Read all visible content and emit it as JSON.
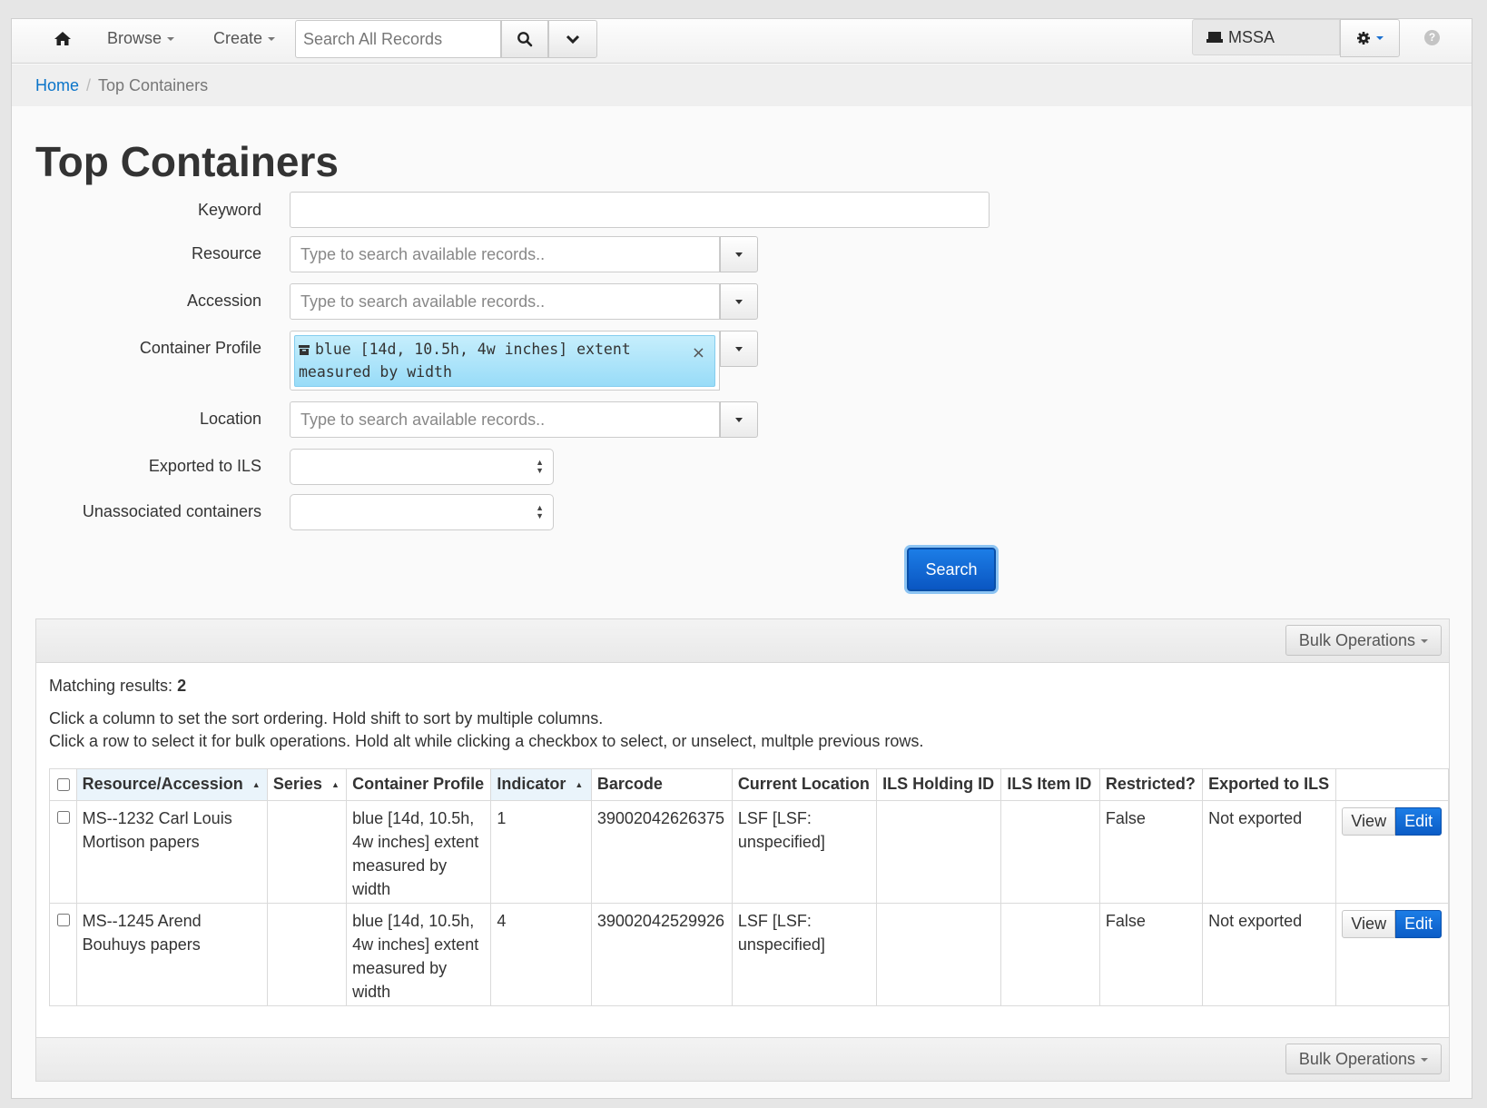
{
  "navbar": {
    "browse_label": "Browse",
    "create_label": "Create",
    "search_placeholder": "Search All Records",
    "repository_label": "MSSA",
    "help_label": "?"
  },
  "breadcrumb": {
    "home": "Home",
    "current": "Top Containers"
  },
  "page_title": "Top Containers",
  "form": {
    "keyword_label": "Keyword",
    "keyword_value": "",
    "resource_label": "Resource",
    "accession_label": "Accession",
    "container_profile_label": "Container Profile",
    "container_profile_token": "blue [14d, 10.5h, 4w inches] extent measured by width",
    "token_close": "×",
    "location_label": "Location",
    "exported_label": "Exported to ILS",
    "unassociated_label": "Unassociated containers",
    "typeahead_placeholder": "Type to search available records..",
    "search_button": "Search"
  },
  "results": {
    "bulk_operations_label": "Bulk Operations",
    "matching_label": "Matching results:",
    "matching_count": "2",
    "help_line_1": "Click a column to set the sort ordering. Hold shift to sort by multiple columns.",
    "help_line_2": "Click a row to select it for bulk operations. Hold alt while clicking a checkbox to select, or unselect, multple previous rows.",
    "columns": {
      "resource": "Resource/Accession",
      "series": "Series",
      "profile": "Container Profile",
      "indicator": "Indicator",
      "barcode": "Barcode",
      "location": "Current Location",
      "ils_holding": "ILS Holding ID",
      "ils_item": "ILS Item ID",
      "restricted": "Restricted?",
      "exported": "Exported to ILS"
    },
    "rows": [
      {
        "resource": "MS--1232 Carl Louis Mortison papers",
        "series": "",
        "profile": "blue [14d, 10.5h, 4w inches] extent measured by width",
        "indicator": "1",
        "barcode": "39002042626375",
        "location": "LSF [LSF: unspecified]",
        "ils_holding": "",
        "ils_item": "",
        "restricted": "False",
        "exported": "Not exported",
        "view_label": "View",
        "edit_label": "Edit"
      },
      {
        "resource": "MS--1245 Arend Bouhuys papers",
        "series": "",
        "profile": "blue [14d, 10.5h, 4w inches] extent measured by width",
        "indicator": "4",
        "barcode": "39002042529926",
        "location": "LSF [LSF: unspecified]",
        "ils_holding": "",
        "ils_item": "",
        "restricted": "False",
        "exported": "Not exported",
        "view_label": "View",
        "edit_label": "Edit"
      }
    ]
  },
  "icons": {
    "home": "home-icon",
    "search": "search-icon",
    "chevron": "chevron-down-icon",
    "repository": "archive-icon",
    "settings": "gear-icon",
    "help": "help-icon"
  }
}
